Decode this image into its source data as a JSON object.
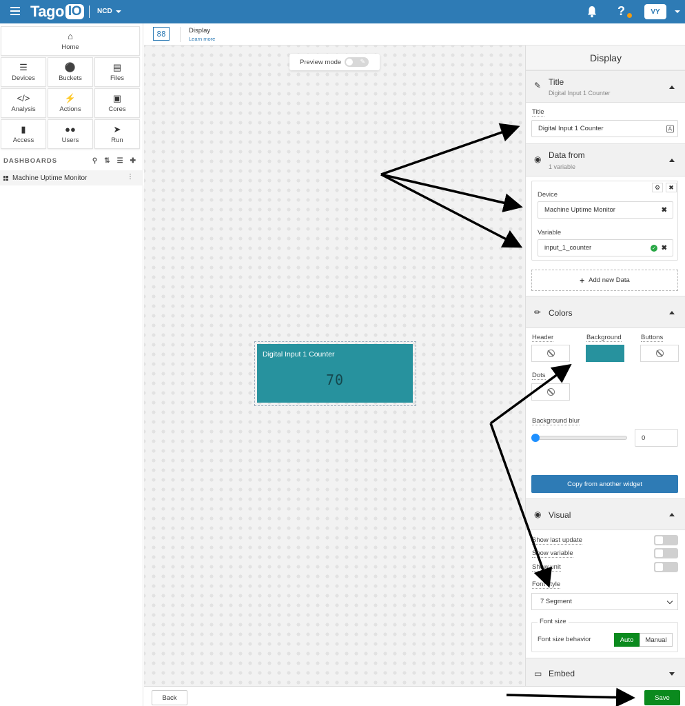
{
  "topbar": {
    "logo_main": "Tago",
    "logo_io": "IO",
    "profile": "NCD",
    "help": "?",
    "avatar": "VY",
    "icons": [
      "menu-icon",
      "bell-icon",
      "help-icon",
      "chevron-down-icon"
    ],
    "accent_color": "#2e7bb5"
  },
  "sidebar": {
    "home": "Home",
    "nav": [
      {
        "label": "Devices",
        "icon": "devices-icon"
      },
      {
        "label": "Buckets",
        "icon": "buckets-icon"
      },
      {
        "label": "Files",
        "icon": "files-icon"
      },
      {
        "label": "Analysis",
        "icon": "code-icon"
      },
      {
        "label": "Actions",
        "icon": "bolt-icon"
      },
      {
        "label": "Cores",
        "icon": "cores-icon"
      },
      {
        "label": "Access",
        "icon": "lock-icon"
      },
      {
        "label": "Users",
        "icon": "users-icon"
      },
      {
        "label": "Run",
        "icon": "rocket-icon"
      }
    ],
    "dashboards_header": "DASHBOARDS",
    "dashboard_item": "Machine Uptime Monitor"
  },
  "subheader": {
    "widget_glyph": "88",
    "title": "Display",
    "learn_more": "Learn more"
  },
  "canvas": {
    "preview_mode": "Preview mode",
    "widget_title": "Digital Input 1 Counter",
    "widget_value": "70",
    "widget_color": "#27929e"
  },
  "panel": {
    "title": "Display",
    "title_section": {
      "name": "Title",
      "sub": "Digital Input 1 Counter",
      "field_label": "Title",
      "field_value": "Digital Input 1 Counter"
    },
    "data_section": {
      "name": "Data from",
      "sub": "1 variable",
      "device_label": "Device",
      "device_value": "Machine Uptime Monitor",
      "variable_label": "Variable",
      "variable_value": "input_1_counter",
      "add_new": "Add new Data"
    },
    "colors_section": {
      "name": "Colors",
      "header": "Header",
      "background": "Background",
      "buttons": "Buttons",
      "dots": "Dots",
      "background_color": "#27929e",
      "blur_label": "Background blur",
      "blur_value": "0",
      "copy": "Copy from another widget"
    },
    "visual_section": {
      "name": "Visual",
      "show_last_update": "Show last update",
      "show_variable": "Show variable",
      "show_unit": "Show unit",
      "font_style_label": "Font style",
      "font_style_value": "7 Segment",
      "font_size_legend": "Font size",
      "font_size_behavior": "Font size behavior",
      "auto": "Auto",
      "manual": "Manual"
    },
    "embed_section": {
      "name": "Embed"
    }
  },
  "bottom": {
    "back": "Back",
    "save": "Save",
    "save_color": "#0b8a1e"
  }
}
